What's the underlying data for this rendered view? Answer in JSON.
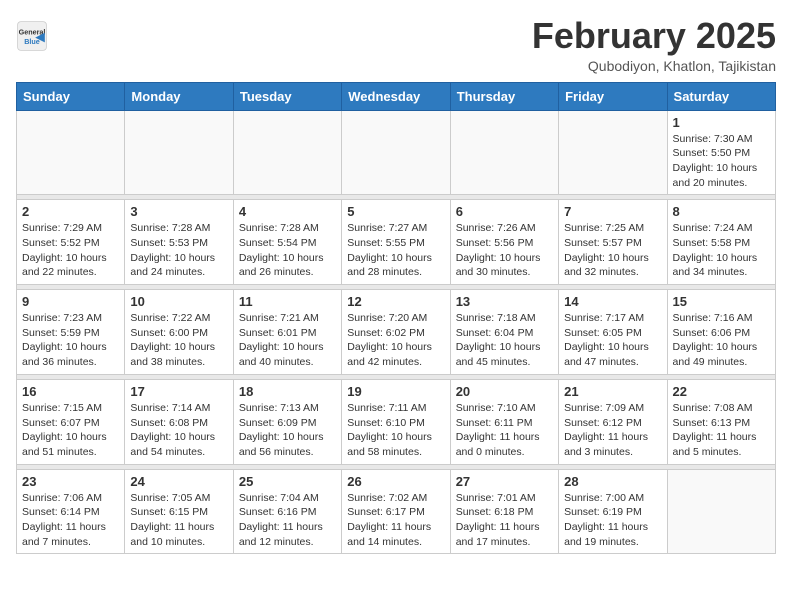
{
  "header": {
    "logo_line1": "General",
    "logo_line2": "Blue",
    "title": "February 2025",
    "subtitle": "Qubodiyon, Khatlon, Tajikistan"
  },
  "days_of_week": [
    "Sunday",
    "Monday",
    "Tuesday",
    "Wednesday",
    "Thursday",
    "Friday",
    "Saturday"
  ],
  "weeks": [
    [
      {
        "day": "",
        "info": ""
      },
      {
        "day": "",
        "info": ""
      },
      {
        "day": "",
        "info": ""
      },
      {
        "day": "",
        "info": ""
      },
      {
        "day": "",
        "info": ""
      },
      {
        "day": "",
        "info": ""
      },
      {
        "day": "1",
        "info": "Sunrise: 7:30 AM\nSunset: 5:50 PM\nDaylight: 10 hours and 20 minutes."
      }
    ],
    [
      {
        "day": "2",
        "info": "Sunrise: 7:29 AM\nSunset: 5:52 PM\nDaylight: 10 hours and 22 minutes."
      },
      {
        "day": "3",
        "info": "Sunrise: 7:28 AM\nSunset: 5:53 PM\nDaylight: 10 hours and 24 minutes."
      },
      {
        "day": "4",
        "info": "Sunrise: 7:28 AM\nSunset: 5:54 PM\nDaylight: 10 hours and 26 minutes."
      },
      {
        "day": "5",
        "info": "Sunrise: 7:27 AM\nSunset: 5:55 PM\nDaylight: 10 hours and 28 minutes."
      },
      {
        "day": "6",
        "info": "Sunrise: 7:26 AM\nSunset: 5:56 PM\nDaylight: 10 hours and 30 minutes."
      },
      {
        "day": "7",
        "info": "Sunrise: 7:25 AM\nSunset: 5:57 PM\nDaylight: 10 hours and 32 minutes."
      },
      {
        "day": "8",
        "info": "Sunrise: 7:24 AM\nSunset: 5:58 PM\nDaylight: 10 hours and 34 minutes."
      }
    ],
    [
      {
        "day": "9",
        "info": "Sunrise: 7:23 AM\nSunset: 5:59 PM\nDaylight: 10 hours and 36 minutes."
      },
      {
        "day": "10",
        "info": "Sunrise: 7:22 AM\nSunset: 6:00 PM\nDaylight: 10 hours and 38 minutes."
      },
      {
        "day": "11",
        "info": "Sunrise: 7:21 AM\nSunset: 6:01 PM\nDaylight: 10 hours and 40 minutes."
      },
      {
        "day": "12",
        "info": "Sunrise: 7:20 AM\nSunset: 6:02 PM\nDaylight: 10 hours and 42 minutes."
      },
      {
        "day": "13",
        "info": "Sunrise: 7:18 AM\nSunset: 6:04 PM\nDaylight: 10 hours and 45 minutes."
      },
      {
        "day": "14",
        "info": "Sunrise: 7:17 AM\nSunset: 6:05 PM\nDaylight: 10 hours and 47 minutes."
      },
      {
        "day": "15",
        "info": "Sunrise: 7:16 AM\nSunset: 6:06 PM\nDaylight: 10 hours and 49 minutes."
      }
    ],
    [
      {
        "day": "16",
        "info": "Sunrise: 7:15 AM\nSunset: 6:07 PM\nDaylight: 10 hours and 51 minutes."
      },
      {
        "day": "17",
        "info": "Sunrise: 7:14 AM\nSunset: 6:08 PM\nDaylight: 10 hours and 54 minutes."
      },
      {
        "day": "18",
        "info": "Sunrise: 7:13 AM\nSunset: 6:09 PM\nDaylight: 10 hours and 56 minutes."
      },
      {
        "day": "19",
        "info": "Sunrise: 7:11 AM\nSunset: 6:10 PM\nDaylight: 10 hours and 58 minutes."
      },
      {
        "day": "20",
        "info": "Sunrise: 7:10 AM\nSunset: 6:11 PM\nDaylight: 11 hours and 0 minutes."
      },
      {
        "day": "21",
        "info": "Sunrise: 7:09 AM\nSunset: 6:12 PM\nDaylight: 11 hours and 3 minutes."
      },
      {
        "day": "22",
        "info": "Sunrise: 7:08 AM\nSunset: 6:13 PM\nDaylight: 11 hours and 5 minutes."
      }
    ],
    [
      {
        "day": "23",
        "info": "Sunrise: 7:06 AM\nSunset: 6:14 PM\nDaylight: 11 hours and 7 minutes."
      },
      {
        "day": "24",
        "info": "Sunrise: 7:05 AM\nSunset: 6:15 PM\nDaylight: 11 hours and 10 minutes."
      },
      {
        "day": "25",
        "info": "Sunrise: 7:04 AM\nSunset: 6:16 PM\nDaylight: 11 hours and 12 minutes."
      },
      {
        "day": "26",
        "info": "Sunrise: 7:02 AM\nSunset: 6:17 PM\nDaylight: 11 hours and 14 minutes."
      },
      {
        "day": "27",
        "info": "Sunrise: 7:01 AM\nSunset: 6:18 PM\nDaylight: 11 hours and 17 minutes."
      },
      {
        "day": "28",
        "info": "Sunrise: 7:00 AM\nSunset: 6:19 PM\nDaylight: 11 hours and 19 minutes."
      },
      {
        "day": "",
        "info": ""
      }
    ]
  ]
}
